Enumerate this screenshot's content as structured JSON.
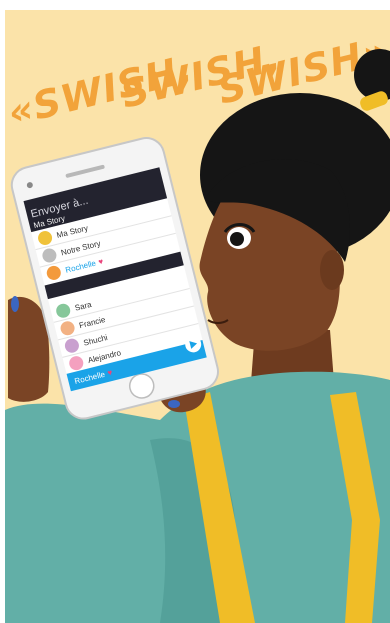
{
  "caption": {
    "line1": "«SWISH,",
    "line2": "SWISH,",
    "line3": "SWISH»"
  },
  "phone": {
    "header_title": "Envoyer à...",
    "section_label": "Ma Story",
    "story_items": [
      {
        "label": "Ma Story",
        "icon": "butterfly-icon"
      },
      {
        "label": "Notre Story",
        "icon": "avatar-icon"
      },
      {
        "label": "Rochelle",
        "icon": "star-icon"
      }
    ],
    "friends": [
      {
        "label": "Sara",
        "avatar_color": "#86c79a"
      },
      {
        "label": "Francie",
        "avatar_color": "#f2b183"
      },
      {
        "label": "Shuchi",
        "avatar_color": "#c9a0cf"
      },
      {
        "label": "Alejandro",
        "avatar_color": "#f4a0bf"
      }
    ],
    "send_bar_label": "Rochelle",
    "send_icon": "send-arrow-icon"
  },
  "colors": {
    "background": "#fbe3a9",
    "caption": "#f2a33a",
    "jacket": "#62afa7",
    "strap": "#f0bd27",
    "skin": "#7a4425",
    "hair": "#151515",
    "accent_blue": "#1aa3e8",
    "header_dark": "#23232f",
    "nail": "#3b66c2"
  }
}
